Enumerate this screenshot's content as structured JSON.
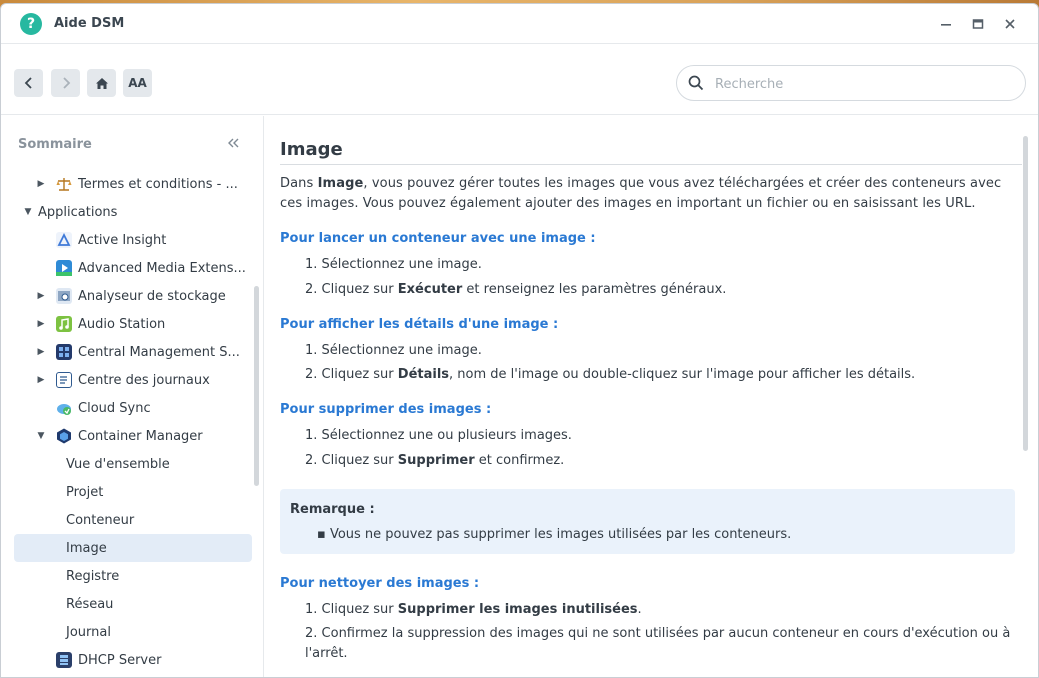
{
  "window": {
    "title": "Aide DSM"
  },
  "search": {
    "placeholder": "Recherche"
  },
  "toolbar": {
    "font_label": "AA"
  },
  "sidebar": {
    "heading": "Sommaire",
    "items": [
      {
        "label": "Termes et conditions - ...",
        "level": 1,
        "expander": "collapsed",
        "icon": "scale-icon"
      },
      {
        "label": "Applications",
        "level": 0,
        "expander": "expanded"
      },
      {
        "label": "Active Insight",
        "level": 1,
        "icon": "active-insight-icon"
      },
      {
        "label": "Advanced Media Extens...",
        "level": 1,
        "icon": "media-extensions-icon"
      },
      {
        "label": "Analyseur de stockage",
        "level": 1,
        "expander": "collapsed",
        "icon": "storage-analyzer-icon"
      },
      {
        "label": "Audio Station",
        "level": 1,
        "expander": "collapsed",
        "icon": "audio-station-icon"
      },
      {
        "label": "Central Management S...",
        "level": 1,
        "expander": "collapsed",
        "icon": "cms-icon"
      },
      {
        "label": "Centre des journaux",
        "level": 1,
        "expander": "collapsed",
        "icon": "log-center-icon"
      },
      {
        "label": "Cloud Sync",
        "level": 1,
        "icon": "cloud-sync-icon"
      },
      {
        "label": "Container Manager",
        "level": 1,
        "expander": "expanded",
        "icon": "container-manager-icon"
      },
      {
        "label": "Vue d'ensemble",
        "level": 2
      },
      {
        "label": "Projet",
        "level": 2
      },
      {
        "label": "Conteneur",
        "level": 2
      },
      {
        "label": "Image",
        "level": 2,
        "selected": true
      },
      {
        "label": "Registre",
        "level": 2
      },
      {
        "label": "Réseau",
        "level": 2
      },
      {
        "label": "Journal",
        "level": 2
      },
      {
        "label": "DHCP Server",
        "level": 1,
        "icon": "dhcp-server-icon"
      }
    ]
  },
  "article": {
    "title": "Image",
    "intro": {
      "pre": "Dans ",
      "bold": "Image",
      "post": ", vous pouvez gérer toutes les images que vous avez téléchargées et créer des conteneurs avec ces images. Vous pouvez également ajouter des images en important un fichier ou en saisissant les URL."
    },
    "s1": {
      "heading": "Pour lancer un conteneur avec une image :",
      "step1": "1. Sélectionnez une image.",
      "step2_pre": "2. Cliquez sur ",
      "step2_bold": "Exécuter",
      "step2_post": " et renseignez les paramètres généraux."
    },
    "s2": {
      "heading": "Pour afficher les détails d'une image :",
      "step1": "1. Sélectionnez une image.",
      "step2_pre": "2. Cliquez sur ",
      "step2_bold": "Détails",
      "step2_post": ", nom de l'image ou double-cliquez sur l'image pour afficher les détails."
    },
    "s3": {
      "heading": "Pour supprimer des images :",
      "step1": "1. Sélectionnez une ou plusieurs images.",
      "step2_pre": "2. Cliquez sur ",
      "step2_bold": "Supprimer",
      "step2_post": " et confirmez."
    },
    "note": {
      "title": "Remarque :",
      "item": "▪ Vous ne pouvez pas supprimer les images utilisées par les conteneurs."
    },
    "s4": {
      "heading": "Pour nettoyer des images :",
      "step1_pre": "1. Cliquez sur ",
      "step1_bold": "Supprimer les images inutilisées",
      "step1_post": ".",
      "step2": "2. Confirmez la suppression des images qui ne sont utilisées par aucun conteneur en cours d'exécution ou à l'arrêt."
    }
  },
  "colors": {
    "accent": "#2a79d3",
    "selection": "#e3ecf7",
    "app_icon": "#27b8a0"
  }
}
